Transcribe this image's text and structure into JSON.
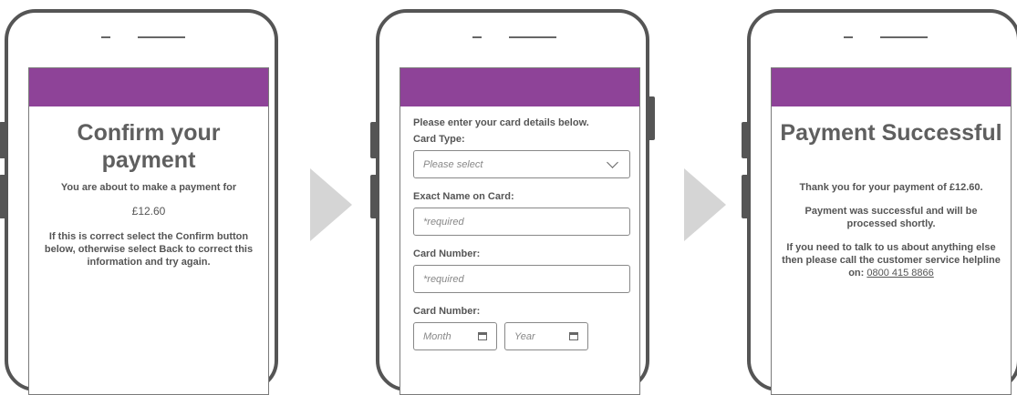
{
  "screen1": {
    "title": "Confirm your payment",
    "intro": "You are about to make a payment for",
    "amount": "£12.60",
    "instructions": "If this is correct select the Confirm button below, otherwise select Back to correct this information and try again."
  },
  "screen2": {
    "intro": "Please enter your card details below.",
    "card_type_label": "Card Type:",
    "card_type_placeholder": "Please select",
    "name_label": "Exact Name on Card:",
    "name_placeholder": "*required",
    "card_number_label": "Card Number:",
    "card_number_placeholder": "*required",
    "expiry_label": "Card Number:",
    "month_placeholder": "Month",
    "year_placeholder": "Year"
  },
  "screen3": {
    "title": "Payment Successful",
    "thanks": "Thank you for your payment of £12.60.",
    "status": "Payment was successful and will be processed shortly.",
    "help_prefix": "If you need to talk to us about anything else then please call the customer service helpline on: ",
    "phone": "0800 415 8866"
  },
  "colors": {
    "header": "#8e4398",
    "arrow": "#d5d5d5",
    "frame": "#555555"
  },
  "icons": [
    "chevron-down-icon",
    "calendar-icon",
    "arrow-right-icon"
  ]
}
